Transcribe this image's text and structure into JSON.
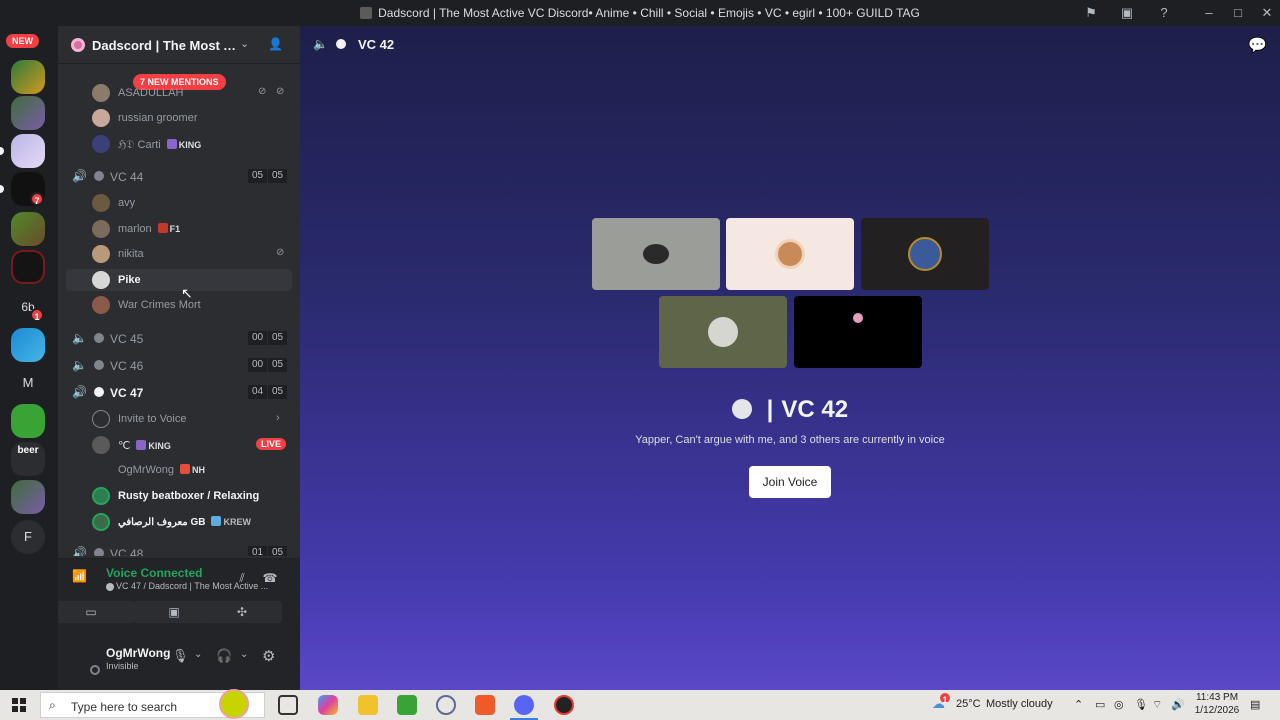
{
  "window": {
    "title": "Dadscord | The Most Active VC Discord• Anime • Chill • Social • Emojis • VC • egirl • 100+ GUILD TAG"
  },
  "rail": {
    "new_badge": "NEW",
    "servers": [
      {
        "name": "server-m",
        "badge": ""
      },
      {
        "name": "server-2",
        "badge": ""
      },
      {
        "name": "server-3",
        "badge": ""
      },
      {
        "name": "server-4",
        "badge": "7"
      },
      {
        "name": "server-minecraft",
        "badge": ""
      },
      {
        "name": "server-6",
        "badge": ""
      },
      {
        "name": "server-6b",
        "badge": "1"
      },
      {
        "name": "server-8",
        "badge": ""
      }
    ],
    "letter_m": "M",
    "beer": "beer",
    "letter_f": "F"
  },
  "server": {
    "name": "Dadscord | The Most Ac...",
    "mentions": "7 NEW MENTIONS"
  },
  "channels": {
    "top_users": [
      {
        "name": "ASADULLAH"
      },
      {
        "name": "russian groomer"
      },
      {
        "name": "ℌ𝔇 Carti",
        "tag": "KING"
      }
    ],
    "vc44": {
      "label": "VC 44",
      "count_a": "05",
      "count_b": "05"
    },
    "vc44_users": [
      {
        "name": "avy"
      },
      {
        "name": "marlon",
        "tag": "F1"
      },
      {
        "name": "nikita"
      },
      {
        "name": "Pike"
      },
      {
        "name": "War Crimes Mort"
      }
    ],
    "vc45": {
      "label": "VC 45",
      "count_a": "00",
      "count_b": "05"
    },
    "vc46": {
      "label": "VC 46",
      "count_a": "00",
      "count_b": "05"
    },
    "vc47": {
      "label": "VC 47",
      "count_a": "04",
      "count_b": "05"
    },
    "invite": "Invite to Voice",
    "vc47_users": [
      {
        "name": "℃",
        "tag": "KING",
        "live": "LIVE"
      },
      {
        "name": "OgMrWong",
        "tag": "NH"
      },
      {
        "name": "Rusty beatboxer / Relaxing"
      },
      {
        "name": "معروف الرصافي GB",
        "tag": "KREW"
      }
    ],
    "vc48": {
      "label": "VC 48",
      "count_a": "01",
      "count_b": "05"
    }
  },
  "voice_panel": {
    "status": "Voice Connected",
    "location": "VC 47 / Dadscord | The Most Active ..."
  },
  "user_panel": {
    "username": "OgMrWong",
    "status": "Invisible"
  },
  "main": {
    "header": "VC 42",
    "vc_title": "VC 42",
    "subtitle": "Yapper, Can't argue with me, and 3 others are currently in voice",
    "join_label": "Join Voice"
  },
  "taskbar": {
    "search_placeholder": "Type here to search",
    "weather_temp": "25°C",
    "weather_desc": "Mostly cloudy",
    "time": "11:43 PM",
    "date": "1/12/2026"
  },
  "colors": {
    "green": "#23a55a",
    "red": "#f23f43",
    "sidebar": "#2b2d31"
  }
}
